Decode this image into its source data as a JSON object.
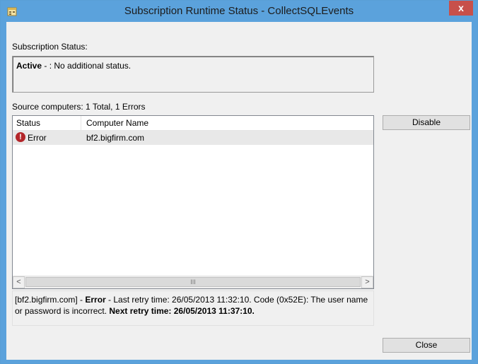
{
  "window": {
    "title": "Subscription Runtime Status - CollectSQLEvents",
    "close_glyph": "x"
  },
  "subscription_status": {
    "label": "Subscription Status:",
    "state_bold": "Active",
    "state_rest": " - : No additional status."
  },
  "source_computers": {
    "label": "Source computers: 1 Total, 1 Errors",
    "columns": [
      "Status",
      "Computer Name"
    ],
    "rows": [
      {
        "status": "Error",
        "computer": "bf2.bigfirm.com"
      }
    ]
  },
  "scrollbar": {
    "left_glyph": "<",
    "right_glyph": ">",
    "thumb_glyph": "III"
  },
  "detail": {
    "part1": "[bf2.bigfirm.com] - ",
    "part2": "Error",
    "part3": " - Last retry time: 26/05/2013 11:32:10. Code (0x52E): The user name or password is incorrect.  ",
    "part4": "Next retry time: 26/05/2013 11:37:10."
  },
  "buttons": {
    "disable": "Disable",
    "close": "Close"
  },
  "colors": {
    "title_bar": "#5ba2dc",
    "close_button": "#c7504a",
    "error_icon": "#b3262a"
  }
}
